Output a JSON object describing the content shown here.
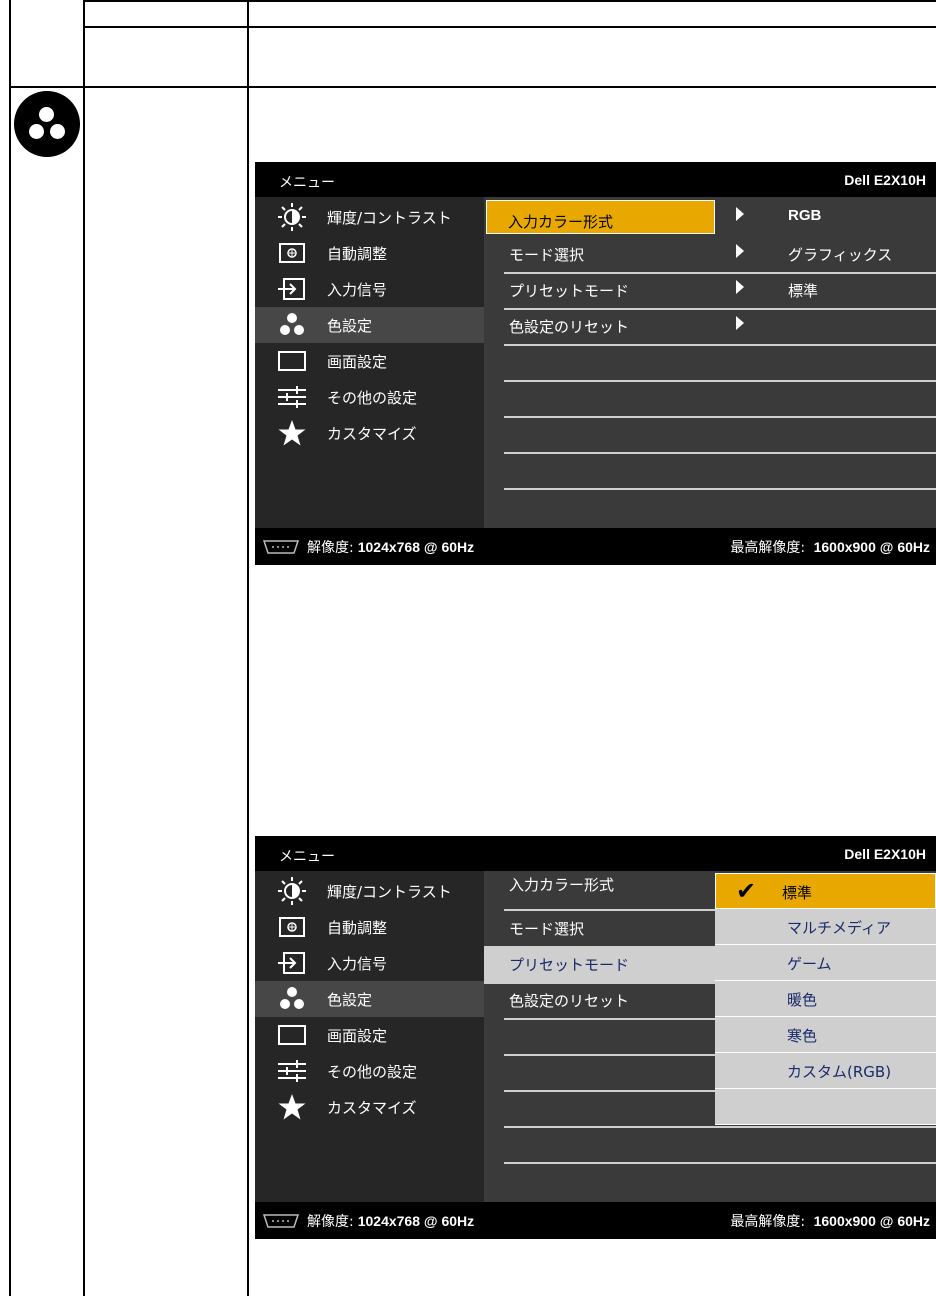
{
  "osd_screens": [
    {
      "title": "メニュー",
      "model": "Dell E2X10H",
      "left_menu": [
        "輝度/コントラスト",
        "自動調整",
        "入力信号",
        "色設定",
        "画面設定",
        "その他の設定",
        "カスタマイズ"
      ],
      "selected_left": "色設定",
      "submenu": [
        {
          "label": "入力カラー形式",
          "value": "RGB"
        },
        {
          "label": "モード選択",
          "value": "グラフィックス"
        },
        {
          "label": "プリセットモード",
          "value": "標準"
        },
        {
          "label": "色設定のリセット",
          "value": ""
        }
      ],
      "footer_resolution_label": "解像度:",
      "footer_resolution_value": "1024x768 @ 60Hz",
      "footer_max_label": "最高解像度:",
      "footer_max_value": "1600x900 @ 60Hz"
    },
    {
      "title": "メニュー",
      "model": "Dell E2X10H",
      "left_menu": [
        "輝度/コントラスト",
        "自動調整",
        "入力信号",
        "色設定",
        "画面設定",
        "その他の設定",
        "カスタマイズ"
      ],
      "selected_left": "色設定",
      "submenu": [
        {
          "label": "入力カラー形式"
        },
        {
          "label": "モード選択"
        },
        {
          "label": "プリセットモード"
        },
        {
          "label": "色設定のリセット"
        }
      ],
      "preset_options": [
        "標準",
        "マルチメディア",
        "ゲーム",
        "暖色",
        "寒色",
        "カスタム(RGB)"
      ],
      "selected_preset": "標準",
      "footer_resolution_label": "解像度:",
      "footer_resolution_value": "1024x768 @ 60Hz",
      "footer_max_label": "最高解像度:",
      "footer_max_value": "1600x900 @ 60Hz"
    }
  ],
  "colors": {
    "highlight": "#e8a800",
    "panel_dark": "#262626",
    "panel_mid": "#3a3a3a",
    "option_bg": "#cfcfcf"
  }
}
